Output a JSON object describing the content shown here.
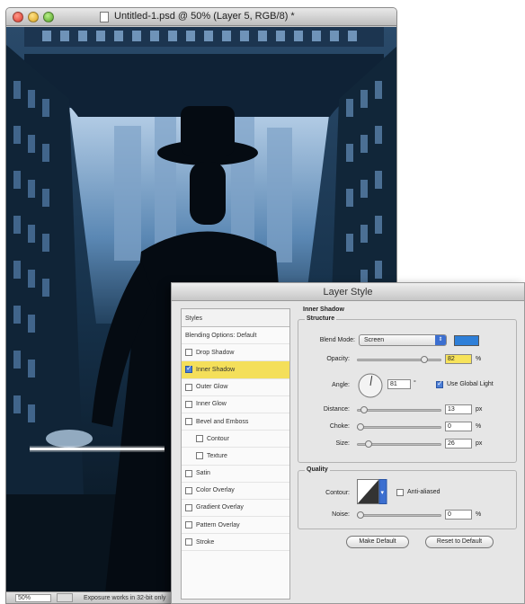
{
  "document_window": {
    "title": "Untitled-1.psd @ 50% (Layer 5, RGB/8) *",
    "status": {
      "zoom": "50%",
      "info": "Exposure works in 32-bit only"
    }
  },
  "dialog": {
    "title": "Layer Style",
    "styles_list": {
      "header": "Styles",
      "items": [
        {
          "label": "Blending Options: Default",
          "checkbox": false,
          "active": false,
          "indent": false
        },
        {
          "label": "Drop Shadow",
          "checkbox": true,
          "checked": false,
          "active": false,
          "indent": false
        },
        {
          "label": "Inner Shadow",
          "checkbox": true,
          "checked": true,
          "active": true,
          "indent": false
        },
        {
          "label": "Outer Glow",
          "checkbox": true,
          "checked": false,
          "active": false,
          "indent": false
        },
        {
          "label": "Inner Glow",
          "checkbox": true,
          "checked": false,
          "active": false,
          "indent": false
        },
        {
          "label": "Bevel and Emboss",
          "checkbox": true,
          "checked": false,
          "active": false,
          "indent": false
        },
        {
          "label": "Contour",
          "checkbox": true,
          "checked": false,
          "active": false,
          "indent": true
        },
        {
          "label": "Texture",
          "checkbox": true,
          "checked": false,
          "active": false,
          "indent": true
        },
        {
          "label": "Satin",
          "checkbox": true,
          "checked": false,
          "active": false,
          "indent": false
        },
        {
          "label": "Color Overlay",
          "checkbox": true,
          "checked": false,
          "active": false,
          "indent": false
        },
        {
          "label": "Gradient Overlay",
          "checkbox": true,
          "checked": false,
          "active": false,
          "indent": false
        },
        {
          "label": "Pattern Overlay",
          "checkbox": true,
          "checked": false,
          "active": false,
          "indent": false
        },
        {
          "label": "Stroke",
          "checkbox": true,
          "checked": false,
          "active": false,
          "indent": false
        }
      ]
    },
    "inner_shadow": {
      "section_title": "Inner Shadow",
      "structure_title": "Structure",
      "blend_mode_label": "Blend Mode:",
      "blend_mode_value": "Screen",
      "shadow_color": "#2e7fd8",
      "opacity_label": "Opacity:",
      "opacity_value": "82",
      "opacity_unit": "%",
      "opacity_level": 0.82,
      "angle_label": "Angle:",
      "angle_value": "81",
      "angle_unit": "°",
      "use_global_light_label": "Use Global Light",
      "use_global_light_checked": true,
      "distance_label": "Distance:",
      "distance_value": "13",
      "distance_unit": "px",
      "distance_level": 0.05,
      "choke_label": "Choke:",
      "choke_value": "0",
      "choke_unit": "%",
      "choke_level": 0.0,
      "size_label": "Size:",
      "size_value": "26",
      "size_unit": "px",
      "size_level": 0.1
    },
    "quality": {
      "title": "Quality",
      "contour_label": "Contour:",
      "anti_aliased_label": "Anti-aliased",
      "anti_aliased_checked": false,
      "noise_label": "Noise:",
      "noise_value": "0",
      "noise_unit": "%",
      "noise_level": 0.0
    },
    "buttons": {
      "make_default": "Make Default",
      "reset_to_default": "Reset to Default"
    }
  }
}
